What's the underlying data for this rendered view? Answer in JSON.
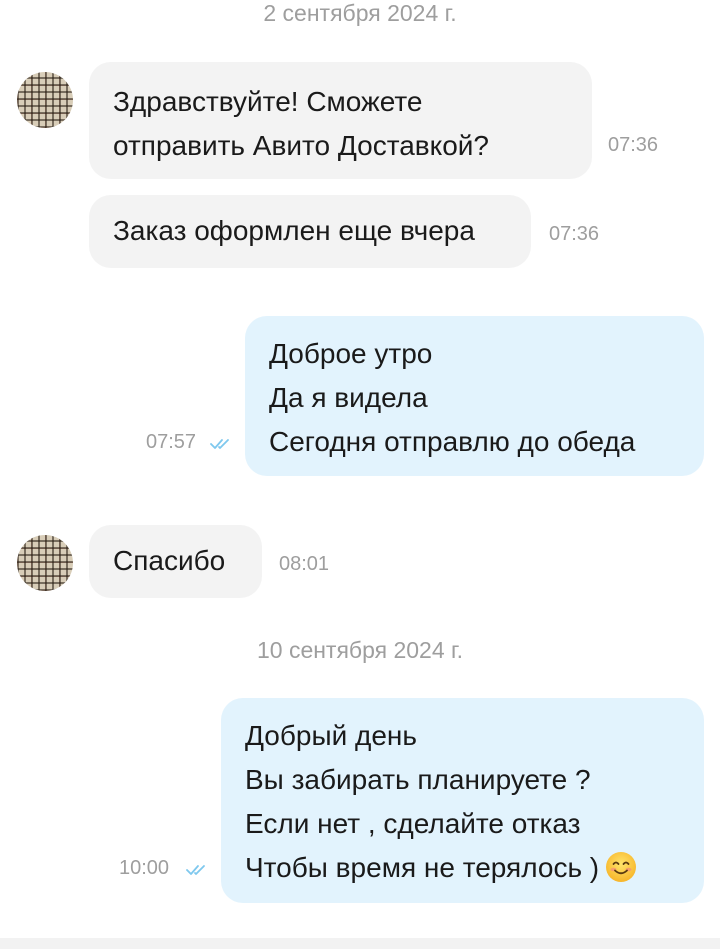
{
  "dates": {
    "first": "2 сентября 2024 г.",
    "second": "10 сентября 2024 г."
  },
  "messages": [
    {
      "direction": "incoming",
      "lines": [
        "Здравствуйте! Сможете",
        "отправить Авито Доставкой?"
      ],
      "time": "07:36"
    },
    {
      "direction": "incoming",
      "lines": [
        "Заказ оформлен еще вчера"
      ],
      "time": "07:36"
    },
    {
      "direction": "outgoing",
      "lines": [
        "Доброе утро",
        "Да я видела",
        "Сегодня отправлю до обеда"
      ],
      "time": "07:57",
      "status_icon": "double-check-icon"
    },
    {
      "direction": "incoming",
      "lines": [
        "Спасибо"
      ],
      "time": "08:01"
    },
    {
      "direction": "outgoing",
      "lines": [
        "Добрый день",
        "Вы забирать планируете ?",
        "Если нет , сделайте отказ",
        "Чтобы время не терялось )"
      ],
      "time": "10:00",
      "status_icon": "double-check-icon",
      "trailing_emoji": "smiling-face-emoji"
    }
  ],
  "colors": {
    "incoming_bubble": "#f3f3f3",
    "outgoing_bubble": "#e2f3fd",
    "meta_text": "#9e9e9e",
    "read_check": "#7ec8ee"
  }
}
